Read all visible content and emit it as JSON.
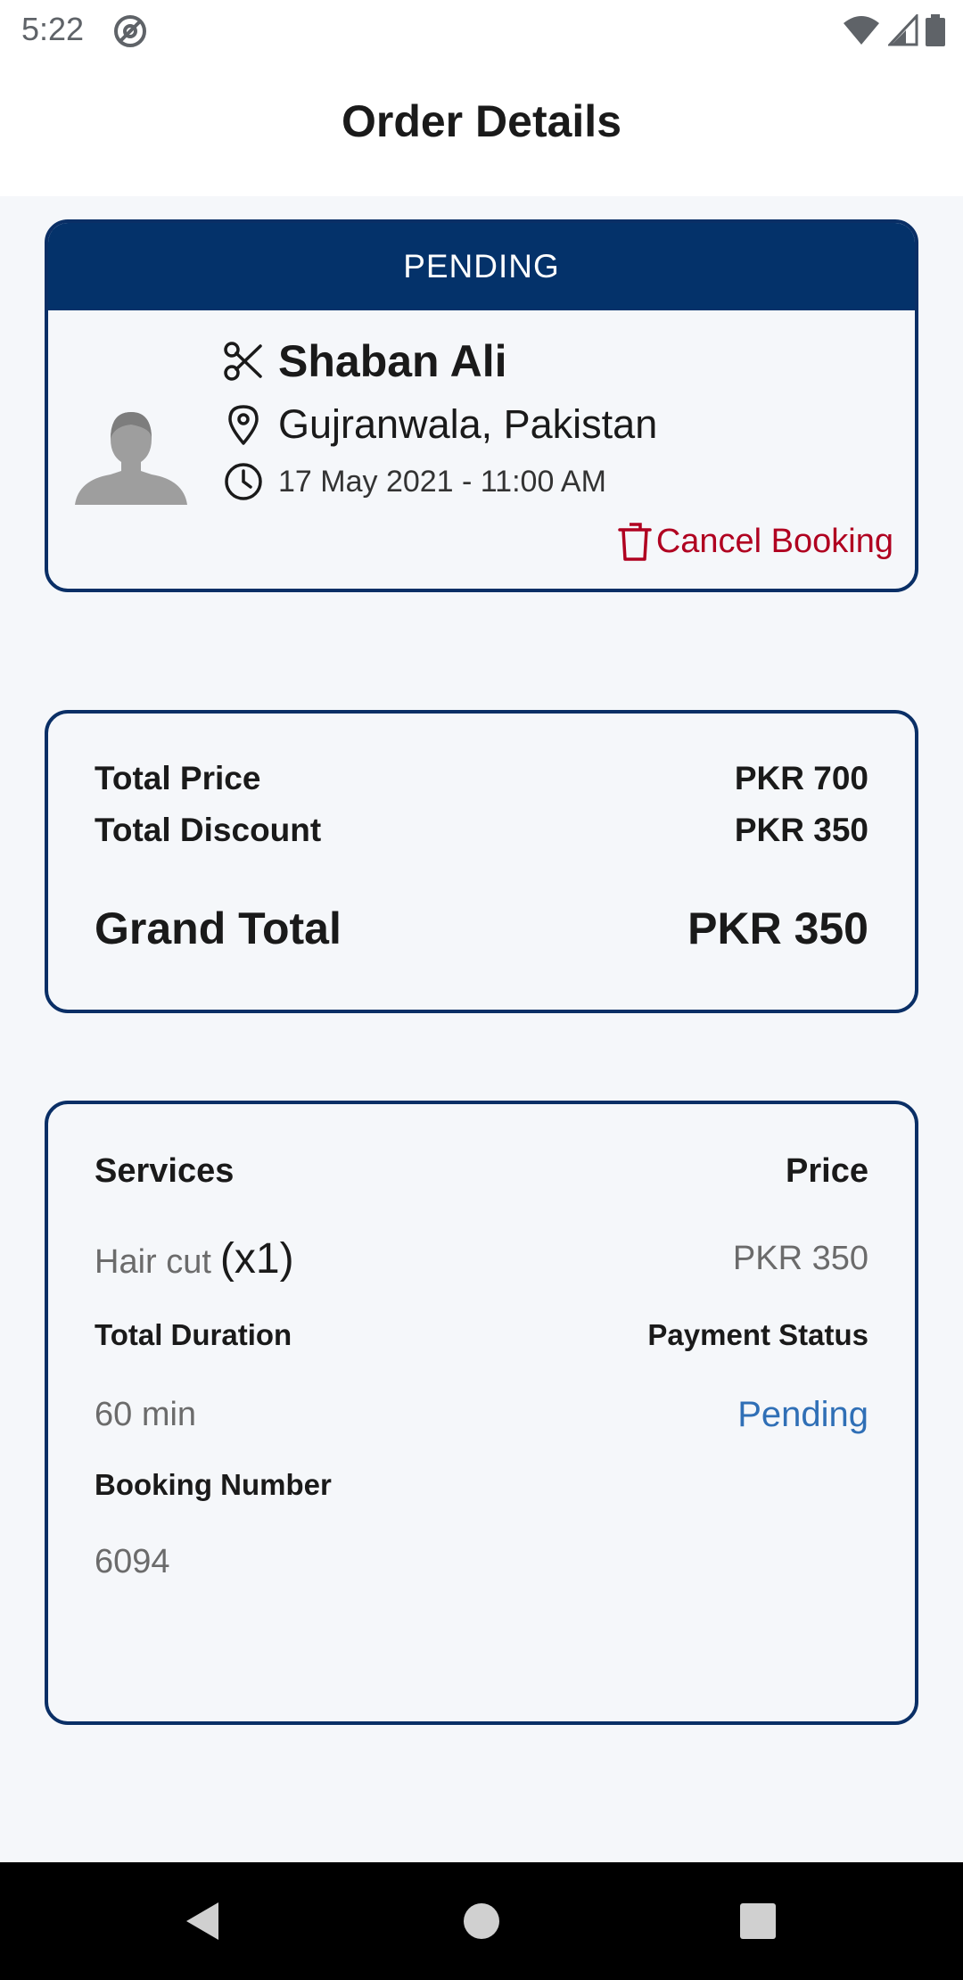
{
  "status_bar": {
    "time": "5:22"
  },
  "app_bar": {
    "title": "Order Details"
  },
  "booking": {
    "status": "PENDING",
    "name": "Shaban Ali",
    "location": "Gujranwala, Pakistan",
    "datetime": "17 May 2021 - 11:00 AM",
    "cancel_label": "Cancel Booking",
    "icons": [
      "scissors-icon",
      "location-pin-icon",
      "clock-icon",
      "trash-icon",
      "avatar-placeholder"
    ]
  },
  "totals": {
    "total_price_label": "Total Price",
    "total_price_value": "PKR 700",
    "total_discount_label": "Total Discount",
    "total_discount_value": "PKR 350",
    "grand_total_label": "Grand Total",
    "grand_total_value": "PKR 350"
  },
  "services": {
    "services_header": "Services",
    "price_header": "Price",
    "items": [
      {
        "name": "Hair cut",
        "qty": "(x1)",
        "price": "PKR 350"
      }
    ],
    "total_duration_label": "Total Duration",
    "total_duration_value": "60 min",
    "payment_status_label": "Payment Status",
    "payment_status_value": "Pending",
    "booking_number_label": "Booking Number",
    "booking_number_value": "6094"
  },
  "colors": {
    "primary": "#04326a",
    "danger": "#b00020",
    "link": "#2f6fb6",
    "background": "#f5f7fa"
  }
}
